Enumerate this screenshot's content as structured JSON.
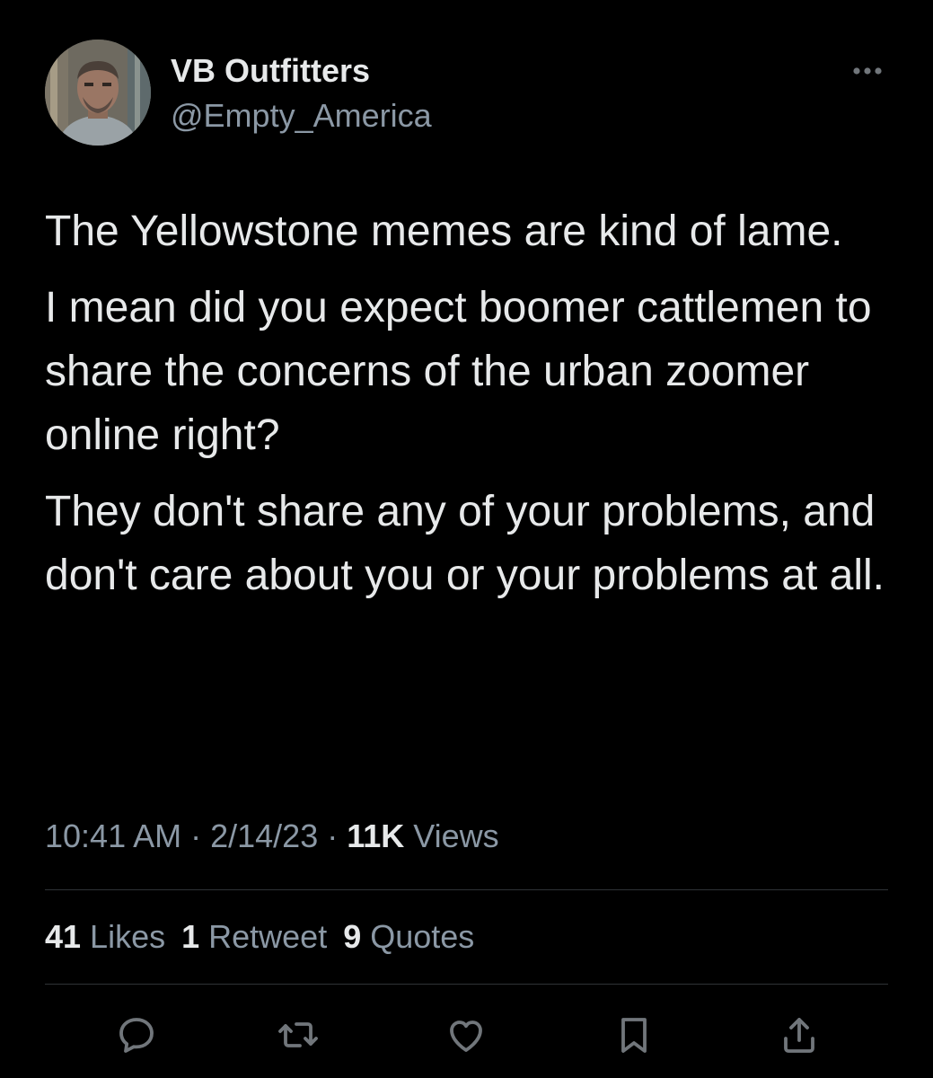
{
  "author": {
    "display_name": "VB Outfitters",
    "handle": "@Empty_America"
  },
  "tweet": {
    "paragraphs": [
      "The Yellowstone memes are kind of lame.",
      "I mean did you expect boomer cattlemen to share the concerns of the urban zoomer online right?",
      "They don't share any of your problems, and don't care about you or your problems at all."
    ]
  },
  "meta": {
    "time": "10:41 AM",
    "sep1": " · ",
    "date": "2/14/23",
    "sep2": " · ",
    "views_count": "11K",
    "views_label": " Views"
  },
  "stats": {
    "likes_count": "41",
    "likes_label": " Likes",
    "retweets_count": "1",
    "retweets_label": " Retweet",
    "quotes_count": "9",
    "quotes_label": " Quotes"
  },
  "actions": [
    "reply-icon",
    "retweet-icon",
    "like-icon",
    "bookmark-icon",
    "share-icon"
  ],
  "colors": {
    "background": "#000000",
    "text_primary": "#e7e9ea",
    "text_secondary": "#8b98a5",
    "divider": "#2f3336"
  }
}
